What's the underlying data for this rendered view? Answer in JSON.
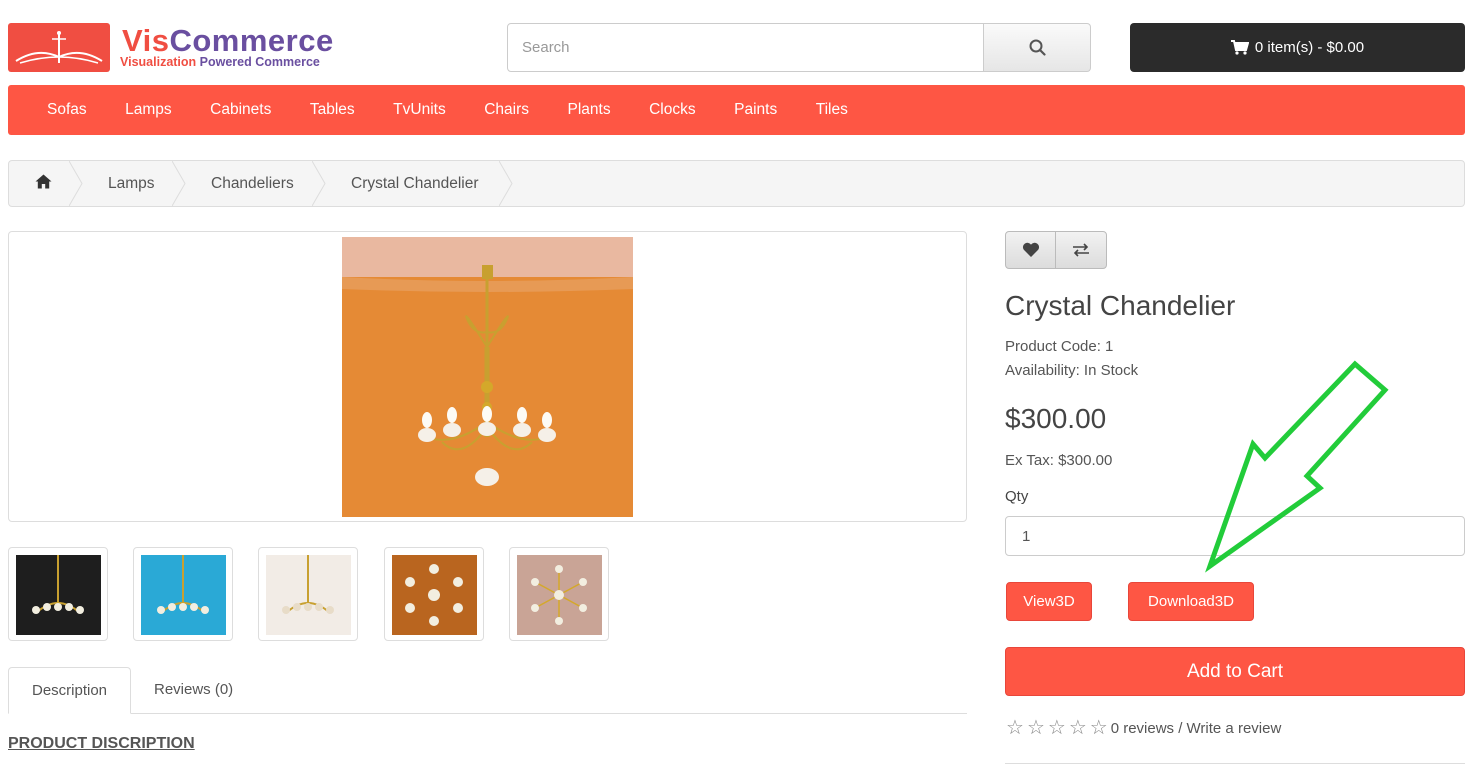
{
  "brand": {
    "name_part1": "Vis",
    "name_part2": "Commerce",
    "tagline_part1": "Visualization",
    "tagline_part2": " Powered Commerce",
    "primary_color": "#f04e42",
    "secondary_color": "#6a4fa0"
  },
  "search": {
    "placeholder": "Search",
    "icon": "search-icon"
  },
  "cart": {
    "label": "0 item(s) - $0.00",
    "icon": "shopping-cart-icon"
  },
  "nav": {
    "items": [
      "Sofas",
      "Lamps",
      "Cabinets",
      "Tables",
      "TvUnits",
      "Chairs",
      "Plants",
      "Clocks",
      "Paints",
      "Tiles"
    ],
    "color": "#fe5644"
  },
  "breadcrumb": {
    "home_icon": "home-icon",
    "items": [
      "Lamps",
      "Chandeliers",
      "Crystal Chandelier"
    ]
  },
  "tabs": {
    "description": "Description",
    "reviews": "Reviews (0)"
  },
  "description": {
    "heading": "PRODUCT DISCRIPTION"
  },
  "product": {
    "title": "Crystal Chandelier",
    "code": "Product Code: 1",
    "availability": "Availability: In Stock",
    "price": "$300.00",
    "ex_tax": "Ex Tax: $300.00",
    "qty_label": "Qty",
    "qty_value": "1",
    "view3d_label": "View3D",
    "download3d_label": "Download3D",
    "add_to_cart_label": "Add to Cart",
    "rating": 0,
    "reviews_text": "0 reviews / Write a review"
  },
  "colors": {
    "accent": "#fe5644",
    "dark": "#2b2b2b",
    "arrow": "#22cc3a"
  }
}
